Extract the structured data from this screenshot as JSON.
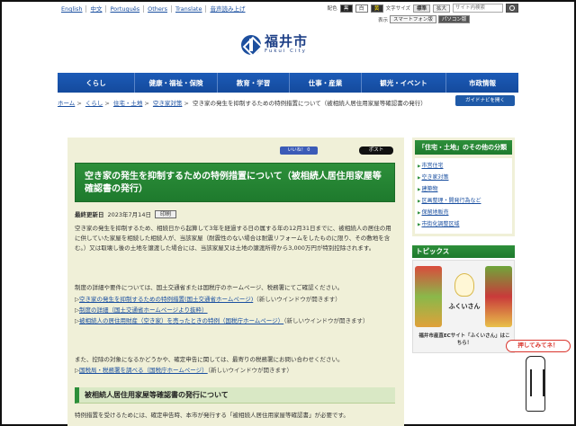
{
  "topbar": {
    "languages": [
      "English",
      "中文",
      "Português",
      "Others",
      "Translate",
      "音声読み上げ"
    ],
    "color_label": "配色",
    "colors": [
      "黒",
      "白",
      "黄"
    ],
    "size_label": "文字サイズ",
    "size_standard": "標準",
    "size_large": "拡大",
    "search_placeholder": "サイト内検索",
    "view_label": "表示",
    "view_smartphone": "スマートフォン版",
    "view_pc": "パソコン版"
  },
  "header": {
    "logo_jp": "福井市",
    "logo_en": "Fukui City"
  },
  "nav": [
    "くらし",
    "健康・福祉・保険",
    "教育・学習",
    "仕事・産業",
    "観光・イベント",
    "市政情報"
  ],
  "breadcrumb": {
    "links": [
      "ホーム",
      "くらし",
      "住宅・土地",
      "空き家対策"
    ],
    "current": "空き家の発生を抑制するための特例措置について（被相続人居住用家屋等確認書の発行）",
    "guide_button": "ガイドナビを開く"
  },
  "social": {
    "facebook": "いいね！ 0",
    "x": "ポスト"
  },
  "article": {
    "title": "空き家の発生を抑制するための特例措置について（被相続人居住用家屋等確認書の発行）",
    "updated_label": "最終更新日",
    "updated_date": "2023年7月14日",
    "print": "印刷",
    "p1": "空き家の発生を抑制するため、相続日から起算して3年を経過する日の属する年の12月31日までに、被相続人の居住の用に供していた家屋を相続した相続人が、当該家屋（耐震性のない場合は耐震リフォームをしたものに限り、その敷地を含む。）又は取壊し後の土地を譲渡した場合には、当該家屋又は土地の譲渡所得から3,000万円が特別控除されます。",
    "p2": "制度の詳細や要件については、国土交通省または国税庁のホームページ、税務署にてご確認ください。",
    "links": [
      {
        "text": "空き家の発生を抑制するための特例措置(国土交通省ホームページ)",
        "note": "（新しいウインドウが開きます）"
      },
      {
        "text": "制度の詳細（国土交通省ホームページより抜粋）",
        "note": ""
      },
      {
        "text": "被相続人の居住用財産（空き家）を売ったときの特例（国税庁ホームページ）",
        "note": "（新しいウインドウが開きます）"
      }
    ],
    "p3": "また、控除の対象になるかどうかや、確定申告に関しては、最寄りの税務署にお問い合わせください。",
    "tax_link": "国税局・税務署を調べる（国税庁ホームページ）",
    "tax_note": "（新しいウインドウが開きます）",
    "h2": "被相続人居住用家屋等確認書の発行について",
    "p4": "特例措置を受けるためには、確定申告時、本市が発行する「被相続人居住用家屋等確認書」が必要です。"
  },
  "sidebar": {
    "category_title": "「住宅・土地」のその他の分類",
    "items": [
      "市営住宅",
      "空き家対策",
      "建築物",
      "区画整理・開発行為など",
      "保留地販売",
      "市街化調整区域"
    ],
    "topics_title": "トピックス",
    "banner_name": "ふくいさん",
    "banner_caption": "福井市産直ECサイト「ふくいさん」はこちら！",
    "push_label": "押してみてネ！"
  }
}
